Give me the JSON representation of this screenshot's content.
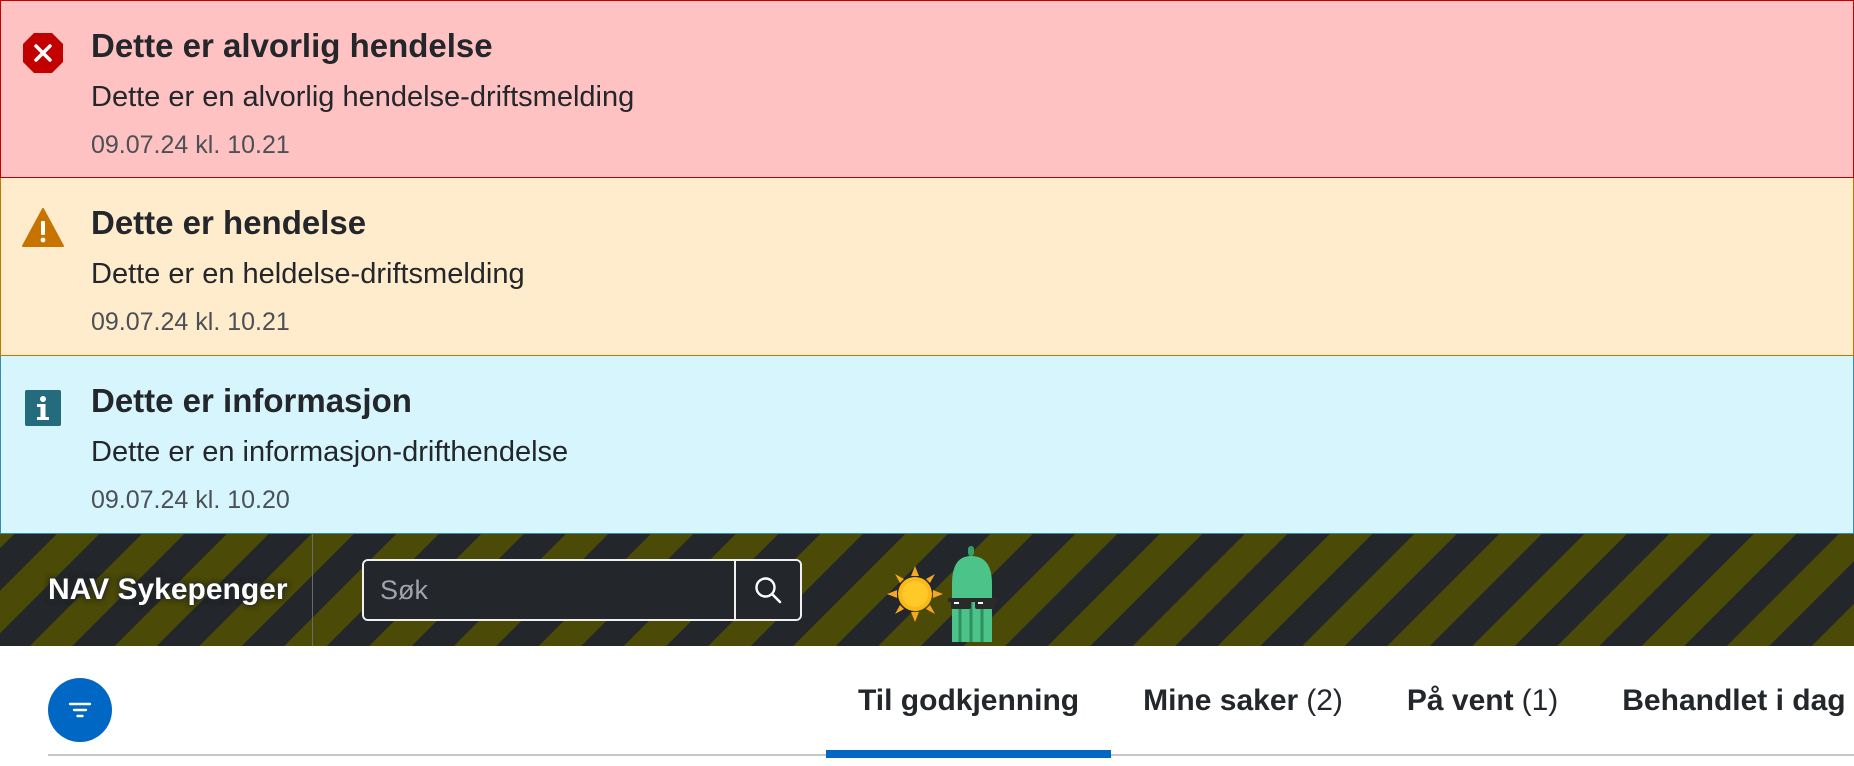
{
  "alerts": [
    {
      "type": "error",
      "icon": "error-octagon-icon",
      "title": "Dette er alvorlig hendelse",
      "body": "Dette er en alvorlig hendelse-driftsmelding",
      "date": "09.07.24 kl. 10.21",
      "color": "#c30000"
    },
    {
      "type": "warning",
      "icon": "warning-triangle-icon",
      "title": "Dette er hendelse",
      "body": "Dette er en heldelse-driftsmelding",
      "date": "09.07.24 kl. 10.21",
      "color": "#c77300"
    },
    {
      "type": "info",
      "icon": "info-square-icon",
      "title": "Dette er informasjon",
      "body": "Dette er en informasjon-drifthendelse",
      "date": "09.07.24 kl. 10.20",
      "color": "#236b7d"
    }
  ],
  "header": {
    "brand": "NAV Sykepenger",
    "search_placeholder": "Søk",
    "search_value": "",
    "mascot": "sun-and-cactus-with-sunglasses"
  },
  "tabs": [
    {
      "label": "Til godkjenning",
      "count": "",
      "active": true
    },
    {
      "label": "Mine saker",
      "count": "(2)",
      "active": false
    },
    {
      "label": "På vent",
      "count": "(1)",
      "active": false
    },
    {
      "label": "Behandlet i dag",
      "count": "",
      "active": false
    }
  ],
  "colors": {
    "accent": "#0067c5",
    "header_bg": "#23262a",
    "header_stripe": "#4b4a06"
  }
}
